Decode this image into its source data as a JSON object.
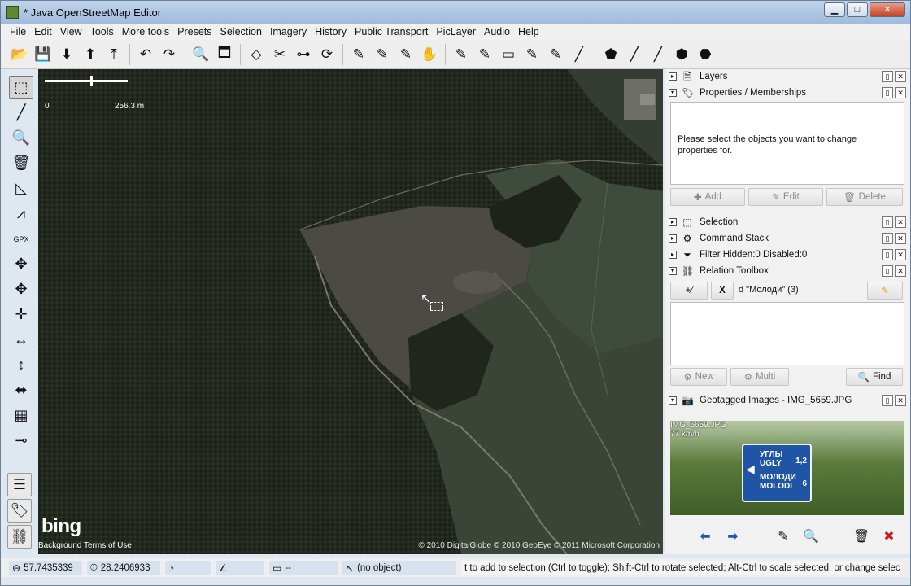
{
  "window": {
    "title": "* Java OpenStreetMap Editor",
    "minimize": "▁",
    "maximize": "□",
    "close": "✕"
  },
  "menu": [
    "File",
    "Edit",
    "View",
    "Tools",
    "More tools",
    "Presets",
    "Selection",
    "Imagery",
    "History",
    "Public Transport",
    "PicLayer",
    "Audio",
    "Help"
  ],
  "toolbar_icons": [
    {
      "name": "open-file-icon",
      "glyph": "📂"
    },
    {
      "name": "save-icon",
      "glyph": "💾"
    },
    {
      "name": "download-icon",
      "glyph": "⬇"
    },
    {
      "name": "update-data-icon",
      "glyph": "⬆"
    },
    {
      "name": "upload-icon",
      "glyph": "⤒"
    },
    {
      "name": "sep"
    },
    {
      "name": "undo-icon",
      "glyph": "↶"
    },
    {
      "name": "redo-icon",
      "glyph": "↷"
    },
    {
      "name": "sep"
    },
    {
      "name": "preferences-icon",
      "glyph": "🔍"
    },
    {
      "name": "validator-icon",
      "glyph": "🗖"
    },
    {
      "name": "sep"
    },
    {
      "name": "combine-way-icon",
      "glyph": "◇"
    },
    {
      "name": "split-way-icon",
      "glyph": "✂"
    },
    {
      "name": "merge-nodes-icon",
      "glyph": "⊶"
    },
    {
      "name": "refresh-icon",
      "glyph": "⟳"
    },
    {
      "name": "sep"
    },
    {
      "name": "draw-tool-a-icon",
      "glyph": "✎"
    },
    {
      "name": "draw-tool-b-icon",
      "glyph": "✎"
    },
    {
      "name": "draw-tool-c-icon",
      "glyph": "✎"
    },
    {
      "name": "hand-icon",
      "glyph": "✋"
    },
    {
      "name": "sep"
    },
    {
      "name": "tool-d-icon",
      "glyph": "✎"
    },
    {
      "name": "tool-e-icon",
      "glyph": "✎"
    },
    {
      "name": "tool-f-icon",
      "glyph": "▭"
    },
    {
      "name": "tool-g-icon",
      "glyph": "✎"
    },
    {
      "name": "tool-h-icon",
      "glyph": "✎"
    },
    {
      "name": "tool-i-icon",
      "glyph": "╱"
    },
    {
      "name": "sep"
    },
    {
      "name": "route-a-icon",
      "glyph": "⬟"
    },
    {
      "name": "route-b-icon",
      "glyph": "╱"
    },
    {
      "name": "route-c-icon",
      "glyph": "╱"
    },
    {
      "name": "map-br-icon",
      "glyph": "⬢"
    },
    {
      "name": "map-us-icon",
      "glyph": "⬣"
    }
  ],
  "left_tools": [
    {
      "name": "select-tool-icon",
      "glyph": "⬚",
      "active": true
    },
    {
      "name": "draw-node-tool-icon",
      "glyph": "╱"
    },
    {
      "name": "zoom-tool-icon",
      "glyph": "🔍"
    },
    {
      "name": "delete-tool-icon",
      "glyph": "🗑"
    },
    {
      "name": "improve-way-tool-icon",
      "glyph": "◺"
    },
    {
      "name": "parallel-way-tool-icon",
      "glyph": "⩘"
    },
    {
      "name": "gpx-tool-icon",
      "glyph": "GPX"
    },
    {
      "name": "move-tool-icon",
      "glyph": "✥"
    },
    {
      "name": "move-node-tool-icon",
      "glyph": "✥"
    },
    {
      "name": "align-tool-icon",
      "glyph": "✛"
    },
    {
      "name": "move-horizontal-icon",
      "glyph": "↔"
    },
    {
      "name": "move-vertical-icon",
      "glyph": "↕"
    },
    {
      "name": "rotate-tool-icon",
      "glyph": "⬌"
    },
    {
      "name": "hatch-tool-icon",
      "glyph": "▦"
    },
    {
      "name": "pointer-tool-icon",
      "glyph": "⊸"
    }
  ],
  "left_bottom": [
    {
      "name": "layers-toggle-icon",
      "glyph": "☰"
    },
    {
      "name": "tags-toggle-icon",
      "glyph": "🏷"
    },
    {
      "name": "relations-toggle-icon",
      "glyph": "⛓"
    }
  ],
  "map": {
    "scale_left": "0",
    "scale_right": "256.3 m",
    "bing": "bing",
    "bing_terms": "Background Terms of Use",
    "copyright": "© 2010 DigitalGlobe © 2010 GeoEye © 2011 Microsoft Corporation"
  },
  "panels": {
    "layers": {
      "title": "Layers",
      "icon": "🗎"
    },
    "properties": {
      "title": "Properties / Memberships",
      "icon": "🏷",
      "message": "Please select the objects you want to change properties for.",
      "add": "Add",
      "edit": "Edit",
      "delete": "Delete"
    },
    "selection": {
      "title": "Selection",
      "icon": "⬚"
    },
    "command_stack": {
      "title": "Command Stack",
      "icon": "⚙"
    },
    "filter": {
      "title": "Filter Hidden:0 Disabled:0",
      "icon": "⏷"
    },
    "relation_toolbox": {
      "title": "Relation Toolbox",
      "icon": "⛓",
      "add_icon": "+∕",
      "x": "X",
      "relation": "d \"Молоди\" (3)",
      "new": "New",
      "multi": "Multi",
      "find": "Find"
    },
    "geotagged": {
      "title": "Geotagged Images - IMG_5659.JPG",
      "icon": "📷",
      "caption_file": "IMG_5659.JPG",
      "caption_speed": "77 km/h",
      "sign_line1": "УГЛЫ",
      "sign_line2": "UGLY",
      "sign_line3": "МОЛОДИ",
      "sign_line4": "MOLODI",
      "sign_num1": "1,2",
      "sign_num2": "6"
    }
  },
  "status": {
    "lat": "57.7435339",
    "lon": "28.2406933",
    "heading": "",
    "angle": "",
    "length": "--",
    "object": "(no object)",
    "help": "t to add to selection (Ctrl to toggle); Shift-Ctrl to rotate selected; Alt-Ctrl to scale selected; or change selection"
  }
}
